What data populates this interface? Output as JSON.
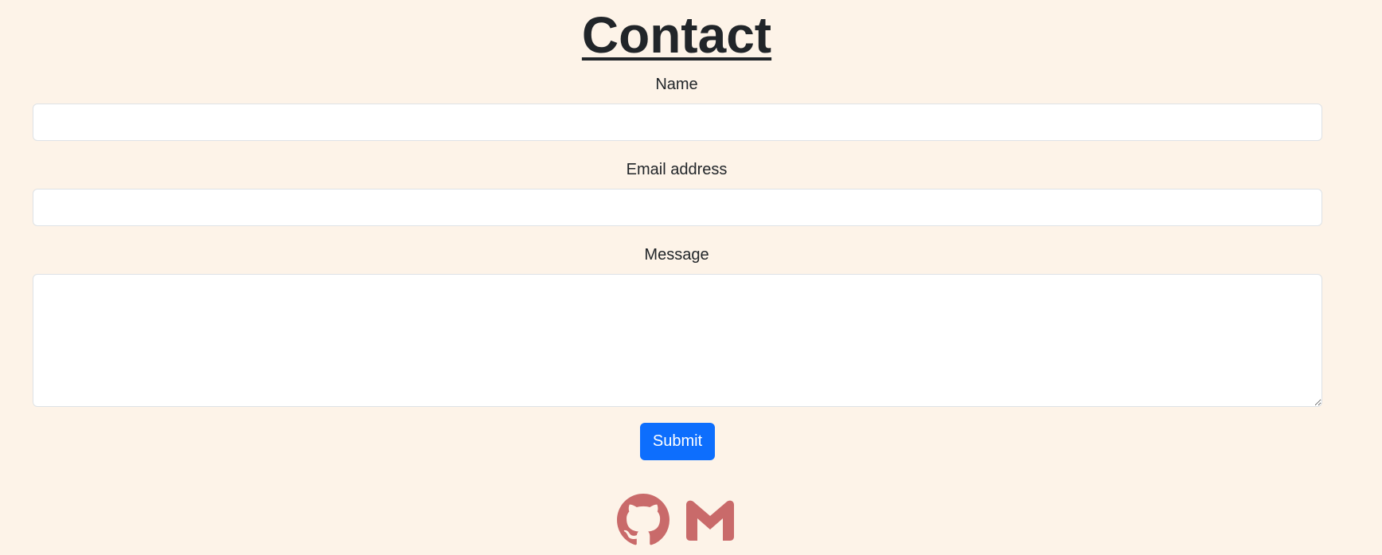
{
  "page": {
    "title": "Contact"
  },
  "form": {
    "name_label": "Name",
    "name_value": "",
    "email_label": "Email address",
    "email_value": "",
    "message_label": "Message",
    "message_value": "",
    "submit_label": "Submit"
  },
  "social": {
    "icons": [
      "github-icon",
      "gmail-icon"
    ]
  },
  "colors": {
    "background": "#fdf3e8",
    "accent": "#0d6efd",
    "icon": "#c96a6a"
  }
}
